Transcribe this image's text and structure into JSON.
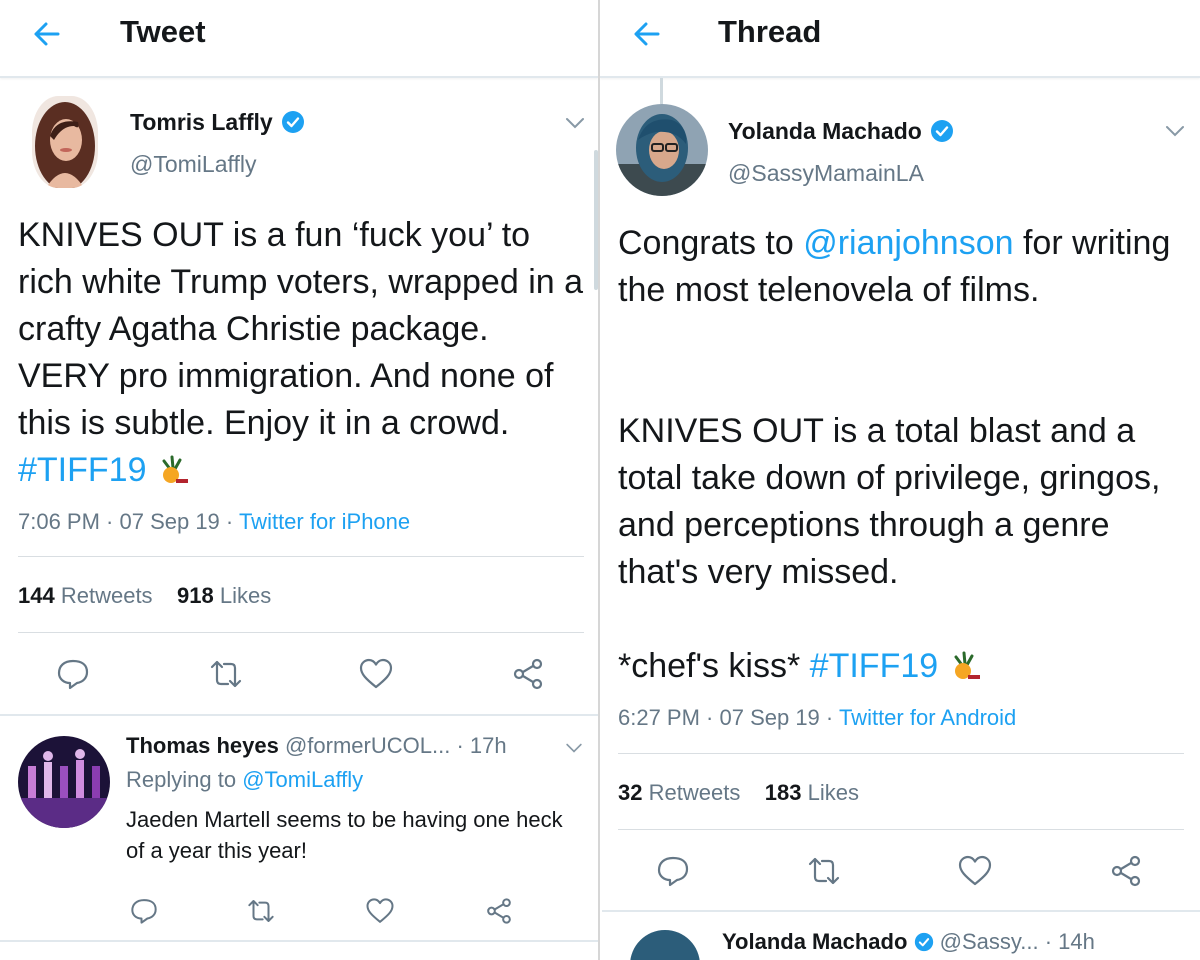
{
  "left": {
    "header_title": "Tweet",
    "tweet": {
      "name": "Tomris Laffly",
      "handle": "@TomiLaffly",
      "text_plain": "KNIVES OUT is a fun ‘fuck you’ to rich white Trump voters, wrapped in a crafty Agatha Christie package. VERY pro immigration. And none of this is subtle. Enjoy it in a crowd. ",
      "hashtag": "#TIFF19",
      "time": "7:06 PM · 07 Sep 19 · ",
      "via": "Twitter for iPhone",
      "retweets_count": "144",
      "retweets_label": "Retweets",
      "likes_count": "918",
      "likes_label": "Likes"
    },
    "reply": {
      "name": "Thomas heyes",
      "handle": "@formerUCOL...",
      "age": "· 17h",
      "replying_prefix": "Replying to ",
      "replying_to": "@TomiLaffly",
      "text": "Jaeden Martell seems to be having one heck of a year this year!"
    }
  },
  "right": {
    "header_title": "Thread",
    "tweet": {
      "name": "Yolanda Machado",
      "handle": "@SassyMamainLA",
      "p1_pre": "Congrats to ",
      "p1_mention": "@rianjohnson",
      "p1_post": " for writing the most telenovela of films.",
      "p2": "KNIVES OUT is a total blast and a total take down of privilege, gringos, and perceptions through a genre that's very missed.",
      "p3_pre": "*chef's kiss* ",
      "hashtag": "#TIFF19",
      "time": "6:27 PM · 07 Sep 19 · ",
      "via": "Twitter for Android",
      "retweets_count": "32",
      "retweets_label": "Retweets",
      "likes_count": "183",
      "likes_label": "Likes"
    },
    "next_preview": {
      "name": "Yolanda Machado",
      "handle": "@Sassy...",
      "age": "· 14h"
    }
  },
  "colors": {
    "accent": "#1da1f2",
    "secondary_text": "#657786",
    "primary_text": "#14171a",
    "divider": "#e1e8ed"
  },
  "icons": [
    "back-arrow-icon",
    "verified-badge-icon",
    "chevron-down-icon",
    "reply-icon",
    "retweet-icon",
    "like-icon",
    "share-icon",
    "tiff-emoji-icon"
  ]
}
